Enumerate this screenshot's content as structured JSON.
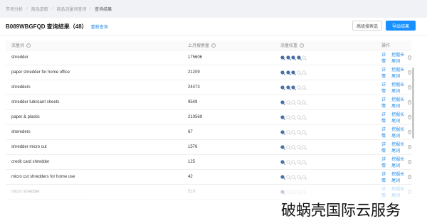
{
  "breadcrumb": [
    "市场分析",
    "商品选取",
    "商品流量词查询",
    "查询结果"
  ],
  "header": {
    "title": "B089WBGFQD 查询结果（48）",
    "requery": "重新查询"
  },
  "buttons": {
    "advanced": "高级搜索选",
    "export": "导出结果"
  },
  "table": {
    "columns": {
      "keyword": "流量词",
      "search_volume": "上月搜索量",
      "traffic_weight": "流量权重",
      "actions": "操作"
    },
    "action_labels": {
      "detail": "详情",
      "mine": "挖掘长尾词"
    },
    "rows": [
      {
        "keyword": "shredder",
        "volume": "175606",
        "weight": 4
      },
      {
        "keyword": "paper shredder for home office",
        "volume": "21209",
        "weight": 3
      },
      {
        "keyword": "shredders",
        "volume": "24473",
        "weight": 3
      },
      {
        "keyword": "shredder lubricant sheets",
        "volume": "9549",
        "weight": 1
      },
      {
        "keyword": "paper & plastic",
        "volume": "210569",
        "weight": 1
      },
      {
        "keyword": "shereders",
        "volume": "67",
        "weight": 1
      },
      {
        "keyword": "shredder micro cut",
        "volume": "1576",
        "weight": 1
      },
      {
        "keyword": "credit card shredder",
        "volume": "125",
        "weight": 1
      },
      {
        "keyword": "micro cut shredders for home use",
        "volume": "42",
        "weight": 1
      },
      {
        "keyword": "micro shredder",
        "volume": "510",
        "weight": 1
      }
    ]
  },
  "watermark": "破蜗壳国际云服务",
  "colors": {
    "accent": "#1890ff",
    "link": "#1e88e5",
    "weight_on": "#4a6fa5",
    "weight_off": "#c9c9c9"
  }
}
